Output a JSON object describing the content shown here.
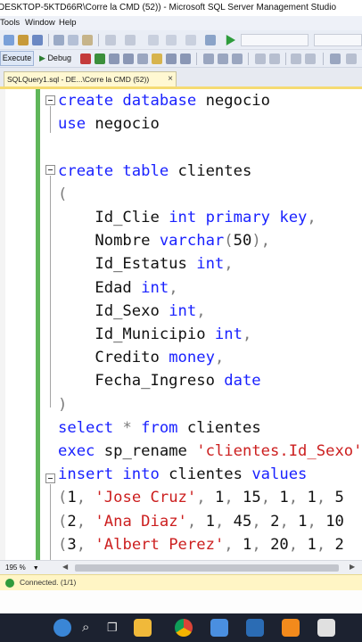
{
  "window": {
    "title": "DESKTOP-5KTD66R\\Corre la CMD (52)) - Microsoft SQL Server Management Studio"
  },
  "menu": {
    "items": [
      "Tools",
      "Window",
      "Help"
    ]
  },
  "toolbar": {
    "execute_label": "Execute",
    "debug_label": "Debug"
  },
  "tab": {
    "label": "SQLQuery1.sql - DE...\\Corre la CMD (52))"
  },
  "editor": {
    "lines": [
      {
        "parts": [
          {
            "t": "create database",
            "c": "kw"
          },
          {
            "t": " negocio",
            "c": ""
          }
        ]
      },
      {
        "parts": [
          {
            "t": "use",
            "c": "kw"
          },
          {
            "t": " negocio",
            "c": ""
          }
        ]
      },
      {
        "parts": []
      },
      {
        "parts": [
          {
            "t": "create table",
            "c": "kw"
          },
          {
            "t": " clientes",
            "c": ""
          }
        ]
      },
      {
        "parts": [
          {
            "t": "(",
            "c": "gray"
          }
        ]
      },
      {
        "parts": [
          {
            "t": "    Id_Clie ",
            "c": ""
          },
          {
            "t": "int primary key",
            "c": "kw"
          },
          {
            "t": ",",
            "c": "gray"
          }
        ]
      },
      {
        "parts": [
          {
            "t": "    Nombre ",
            "c": ""
          },
          {
            "t": "varchar",
            "c": "kw"
          },
          {
            "t": "(",
            "c": "gray"
          },
          {
            "t": "50",
            "c": ""
          },
          {
            "t": "),",
            "c": "gray"
          }
        ]
      },
      {
        "parts": [
          {
            "t": "    Id_Estatus ",
            "c": ""
          },
          {
            "t": "int",
            "c": "kw"
          },
          {
            "t": ",",
            "c": "gray"
          }
        ]
      },
      {
        "parts": [
          {
            "t": "    Edad ",
            "c": ""
          },
          {
            "t": "int",
            "c": "kw"
          },
          {
            "t": ",",
            "c": "gray"
          }
        ]
      },
      {
        "parts": [
          {
            "t": "    Id_Sexo ",
            "c": ""
          },
          {
            "t": "int",
            "c": "kw"
          },
          {
            "t": ",",
            "c": "gray"
          }
        ]
      },
      {
        "parts": [
          {
            "t": "    Id_Municipio ",
            "c": ""
          },
          {
            "t": "int",
            "c": "kw"
          },
          {
            "t": ",",
            "c": "gray"
          }
        ]
      },
      {
        "parts": [
          {
            "t": "    Credito ",
            "c": ""
          },
          {
            "t": "money",
            "c": "kw"
          },
          {
            "t": ",",
            "c": "gray"
          }
        ]
      },
      {
        "parts": [
          {
            "t": "    Fecha_Ingreso ",
            "c": ""
          },
          {
            "t": "date",
            "c": "kw"
          }
        ]
      },
      {
        "parts": [
          {
            "t": ")",
            "c": "gray"
          }
        ]
      },
      {
        "parts": [
          {
            "t": "select",
            "c": "kw"
          },
          {
            "t": " * ",
            "c": "gray"
          },
          {
            "t": "from",
            "c": "kw"
          },
          {
            "t": " clientes",
            "c": ""
          }
        ]
      },
      {
        "parts": [
          {
            "t": "exec",
            "c": "kw"
          },
          {
            "t": " sp_rename ",
            "c": ""
          },
          {
            "t": "'clientes.Id_Sexo'",
            "c": "str"
          }
        ]
      },
      {
        "parts": [
          {
            "t": "insert into",
            "c": "kw"
          },
          {
            "t": " clientes ",
            "c": ""
          },
          {
            "t": "values",
            "c": "kw"
          }
        ]
      },
      {
        "parts": [
          {
            "t": "(",
            "c": "gray"
          },
          {
            "t": "1",
            "c": ""
          },
          {
            "t": ", ",
            "c": "gray"
          },
          {
            "t": "'Jose Cruz'",
            "c": "str"
          },
          {
            "t": ", ",
            "c": "gray"
          },
          {
            "t": "1",
            "c": ""
          },
          {
            "t": ", ",
            "c": "gray"
          },
          {
            "t": "15",
            "c": ""
          },
          {
            "t": ", ",
            "c": "gray"
          },
          {
            "t": "1",
            "c": ""
          },
          {
            "t": ", ",
            "c": "gray"
          },
          {
            "t": "1",
            "c": ""
          },
          {
            "t": ", ",
            "c": "gray"
          },
          {
            "t": "5",
            "c": ""
          }
        ]
      },
      {
        "parts": [
          {
            "t": "(",
            "c": "gray"
          },
          {
            "t": "2",
            "c": ""
          },
          {
            "t": ", ",
            "c": "gray"
          },
          {
            "t": "'Ana Diaz'",
            "c": "str"
          },
          {
            "t": ", ",
            "c": "gray"
          },
          {
            "t": "1",
            "c": ""
          },
          {
            "t": ", ",
            "c": "gray"
          },
          {
            "t": "45",
            "c": ""
          },
          {
            "t": ", ",
            "c": "gray"
          },
          {
            "t": "2",
            "c": ""
          },
          {
            "t": ", ",
            "c": "gray"
          },
          {
            "t": "1",
            "c": ""
          },
          {
            "t": ", ",
            "c": "gray"
          },
          {
            "t": "10",
            "c": ""
          }
        ]
      },
      {
        "parts": [
          {
            "t": "(",
            "c": "gray"
          },
          {
            "t": "3",
            "c": ""
          },
          {
            "t": ", ",
            "c": "gray"
          },
          {
            "t": "'Albert Perez'",
            "c": "str"
          },
          {
            "t": ", ",
            "c": "gray"
          },
          {
            "t": "1",
            "c": ""
          },
          {
            "t": ", ",
            "c": "gray"
          },
          {
            "t": "20",
            "c": ""
          },
          {
            "t": ", ",
            "c": "gray"
          },
          {
            "t": "1",
            "c": ""
          },
          {
            "t": ", ",
            "c": "gray"
          },
          {
            "t": "2",
            "c": ""
          }
        ]
      }
    ]
  },
  "zoom": {
    "value": "195 %"
  },
  "status": {
    "text": "Connected. (1/1)"
  },
  "taskbar": {
    "icons": [
      "weather-icon",
      "search-icon",
      "task-view-icon",
      "file-explorer-icon",
      "chrome-icon",
      "store-icon",
      "terminal-icon",
      "sublime-icon",
      "ssms-icon"
    ]
  },
  "colors": {
    "keyword": "#1a22ff",
    "string": "#cc1f1f",
    "punctuation": "#7a7a7a",
    "status_bar": "#fff5c5",
    "tab_active": "#fff8d2",
    "change_marker": "#5fb65a"
  }
}
